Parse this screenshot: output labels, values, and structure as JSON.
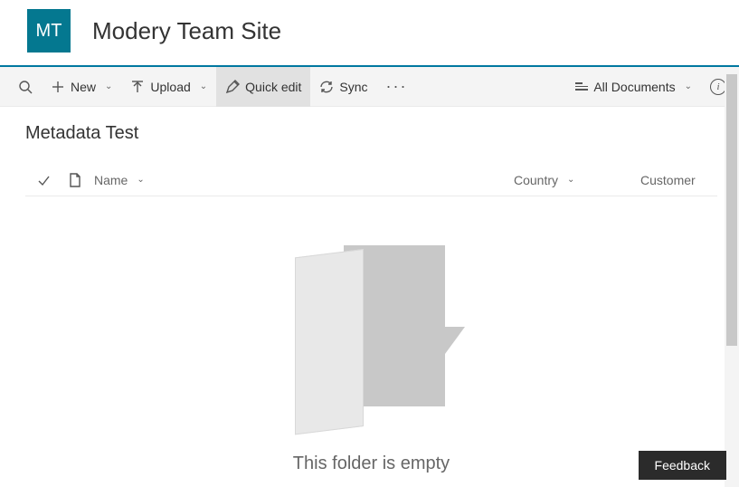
{
  "header": {
    "logo_text": "MT",
    "site_title": "Modery Team Site"
  },
  "toolbar": {
    "new_label": "New",
    "upload_label": "Upload",
    "quickedit_label": "Quick edit",
    "sync_label": "Sync",
    "view_label": "All Documents"
  },
  "library": {
    "title": "Metadata Test",
    "columns": {
      "name": "Name",
      "country": "Country",
      "customer": "Customer"
    },
    "empty_message": "This folder is empty"
  },
  "feedback": {
    "label": "Feedback"
  }
}
